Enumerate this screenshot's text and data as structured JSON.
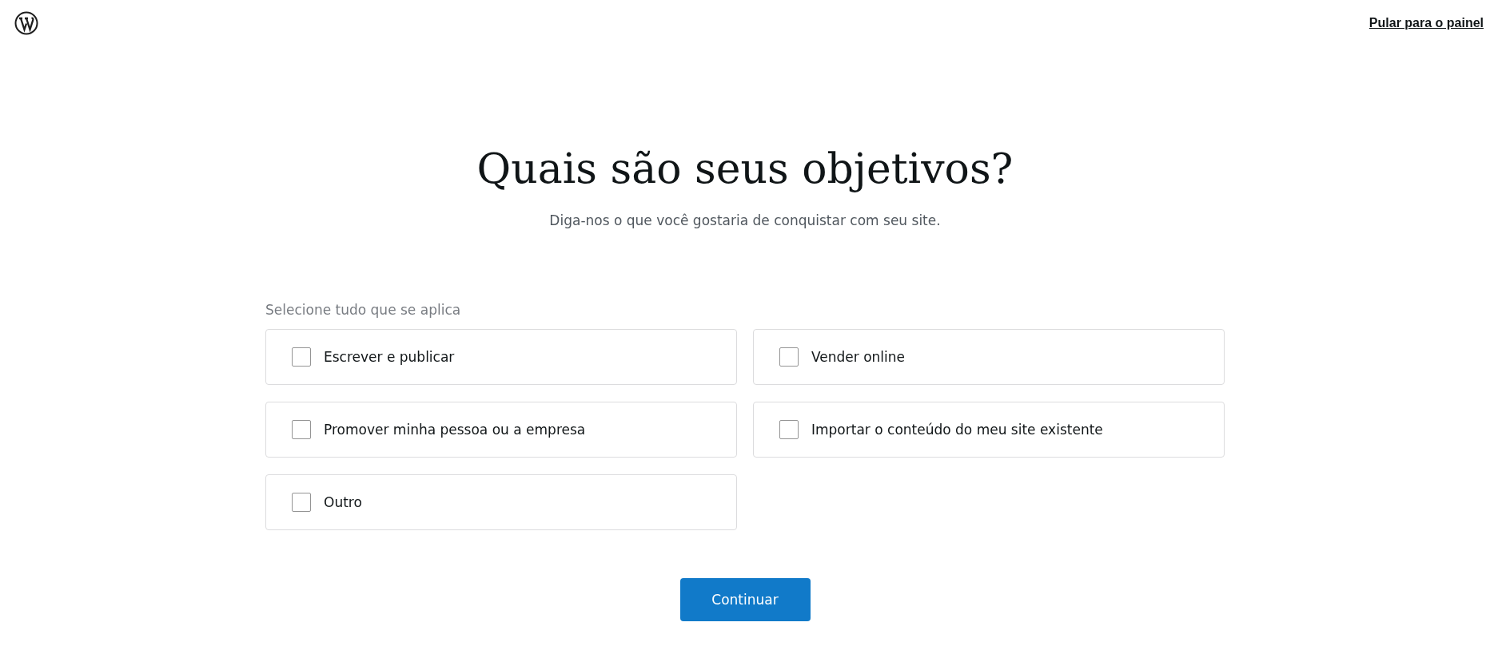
{
  "header": {
    "skip_link": "Pular para o painel"
  },
  "title": "Quais são seus objetivos?",
  "subtitle": "Diga-nos o que você gostaria de conquistar com seu site.",
  "hint": "Selecione tudo que se aplica",
  "goals": [
    {
      "label": "Escrever e publicar",
      "checked": false
    },
    {
      "label": "Vender online",
      "checked": false
    },
    {
      "label": "Promover minha pessoa ou a empresa",
      "checked": false
    },
    {
      "label": "Importar o conteúdo do meu site existente",
      "checked": false
    },
    {
      "label": "Outro",
      "checked": false
    }
  ],
  "continue_button": "Continuar"
}
